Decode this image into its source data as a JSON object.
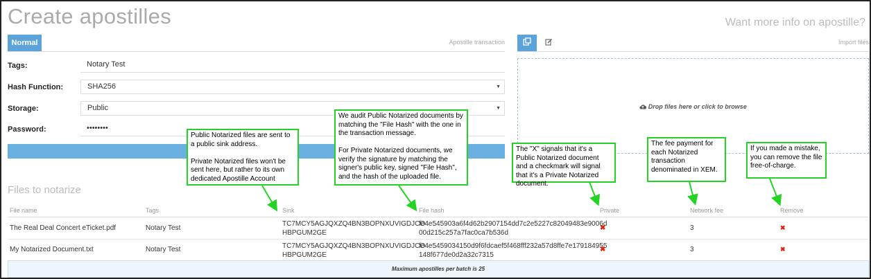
{
  "header": {
    "title": "Create apostilles",
    "info_link": "Want more info on apostille?"
  },
  "left_tabs": {
    "active_tab": "Normal",
    "right_label": "Apostille transaction"
  },
  "form": {
    "tags_label": "Tags:",
    "tags_value": "Notary Test",
    "hash_label": "Hash Function:",
    "hash_value": "SHA256",
    "storage_label": "Storage:",
    "storage_value": "Public",
    "password_label": "Password:",
    "password_value": "••••••••"
  },
  "import_panel": {
    "label": "Import files",
    "drop_text": "Drop files here or click to browse"
  },
  "files": {
    "section_title": "Files to notarize",
    "columns": [
      "File name",
      "Tags",
      "Sink",
      "File hash",
      "Private",
      "Network fee",
      "Remove"
    ],
    "rows": [
      {
        "file_name": "The Real Deal Concert eTicket.pdf",
        "tags": "Notary Test",
        "sink_line1": "TC7MCY5AGJQXZQ4BN3BOPNXUVIGDJCO",
        "sink_line2": "HBPGUM2GE",
        "hash_line1": "fe4e545903a6f4d62b2907154dd7c2e5227c82049483e9006d",
        "hash_line2": "00d215c257a7fac0ca7b536d",
        "private": "✖",
        "fee": "3",
        "remove": "✖"
      },
      {
        "file_name": "My Notarized Document.txt",
        "tags": "Notary Test",
        "sink_line1": "TC7MCY5AGJQXZQ4BN3BOPNXUVIGDJCO",
        "sink_line2": "HBPGUM2GE",
        "hash_line1": "fe4e5459034150d9f6fdcaef5f468fff232a57d8ffe7e179184955",
        "hash_line2": "148f677de0d2a32c7315",
        "private": "✖",
        "fee": "3",
        "remove": "✖"
      }
    ],
    "footer": "Maximum apostilles per batch is 25"
  },
  "callouts": {
    "sink": "Public Notarized files are sent to a public sink address.\n\nPrivate Notarized files won't be sent here, but rather to its own dedicated Apostille Account",
    "hash": "We audit Public Notarized documents by matching the \"File Hash\" with the one in the transaction message.\n\nFor Private Notarized documents, we verify the signature by matching the signer's public key, signed \"File Hash\", and the hash of the uploaded file.",
    "private": "The \"X\" signals that it's a Public Notarized document and a checkmark will signal that it's a Private Notarized document.",
    "fee": "The fee payment for each Notarized transaction denominated in XEM.",
    "remove": "If you made a mistake, you can remove the file free-of-charge."
  },
  "icons": {
    "copy_tab": "copy-icon",
    "edit_tab": "edit-icon",
    "cloud": "cloud-upload-icon",
    "select_caret": "chevron-down-icon",
    "remove": "close-icon"
  },
  "colors": {
    "accent": "#5ba3d9",
    "callout_border": "#25d325",
    "remove_red": "#d21"
  }
}
